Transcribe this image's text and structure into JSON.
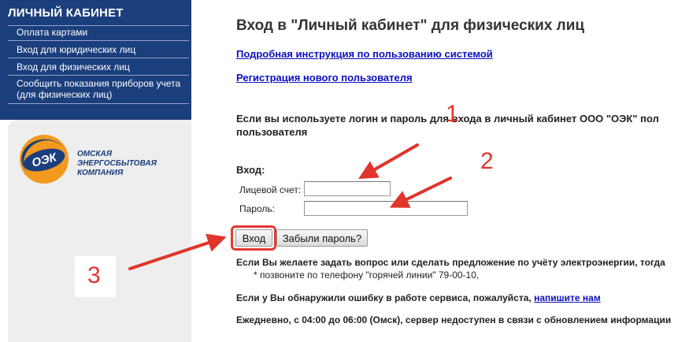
{
  "sidebar": {
    "title": "ЛИЧНЫЙ КАБИНЕТ",
    "items": [
      {
        "label": "Оплата картами"
      },
      {
        "label": "Вход для юридических лиц"
      },
      {
        "label": "Вход для физических лиц"
      },
      {
        "label": "Сообщить показания приборов учета"
      },
      {
        "label": "(для физических лиц)"
      }
    ],
    "logo": {
      "mark": "ОЭК",
      "line1": "ОМСКАЯ",
      "line2": "ЭНЕРГОСБЫТОВАЯ",
      "line3": "КОМПАНИЯ"
    }
  },
  "main": {
    "title": "Вход в \"Личный кабинет\" для физических лиц",
    "links": {
      "instructions": "Подробная инструкция по пользованию системой",
      "register": "Регистрация нового пользователя"
    },
    "intro_line1": "Если вы используете логин и пароль для входа в личный кабинет ООО \"ОЭК\" пол",
    "intro_line2": "пользователя",
    "login": {
      "heading": "Вход:",
      "account_label": "Лицевой счет:",
      "account_value": "",
      "password_label": "Пароль:",
      "password_value": "",
      "submit_label": "Вход",
      "forgot_label": "Забыли пароль?"
    },
    "notes": {
      "question": "Если Вы желаете задать вопрос или сделать предложение по учёту электроэнергии, тогда",
      "hotline": "* позвоните по телефону \"горячей линии\" 79-00-10,",
      "error_prefix": "Если у Вы обнаружили ошибку в работе сервиса, пожалуйста,",
      "error_link": "напишите нам",
      "maintenance": "Ежедневно, с 04:00 до 06:00 (Омск), сервер недоступен в связи с обновлением информации"
    }
  },
  "annotations": {
    "n1": "1",
    "n2": "2",
    "n3": "3",
    "color": "#e0352b"
  }
}
